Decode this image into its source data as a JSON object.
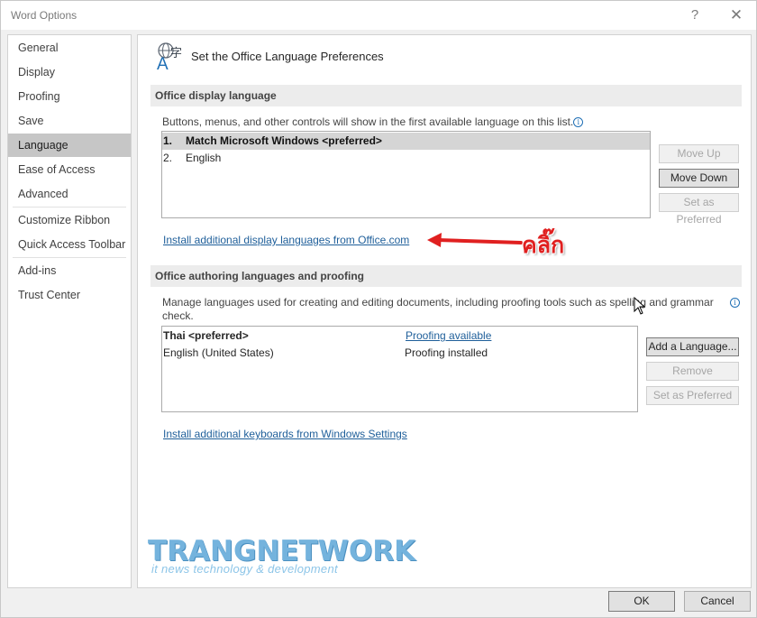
{
  "window": {
    "title": "Word Options",
    "help_glyph": "?",
    "close_glyph": "✕"
  },
  "sidebar": {
    "items": [
      {
        "label": "General"
      },
      {
        "label": "Display"
      },
      {
        "label": "Proofing"
      },
      {
        "label": "Save"
      },
      {
        "label": "Language",
        "selected": true
      },
      {
        "label": "Ease of Access"
      },
      {
        "label": "Advanced"
      },
      {
        "label": "Customize Ribbon"
      },
      {
        "label": "Quick Access Toolbar"
      },
      {
        "label": "Add-ins"
      },
      {
        "label": "Trust Center"
      }
    ]
  },
  "page": {
    "title": "Set the Office Language Preferences",
    "icon_glyph_a": "A",
    "icon_glyph_b": "字",
    "icon": "language-icon"
  },
  "display_language": {
    "heading": "Office display language",
    "description": "Buttons, menus, and other controls will show in the first available language on this list.",
    "languages": [
      {
        "num": "1.",
        "name": "Match Microsoft Windows <preferred>",
        "selected": true
      },
      {
        "num": "2.",
        "name": "English"
      }
    ],
    "move_up_label": "Move Up",
    "move_down_label": "Move Down",
    "set_preferred_label": "Set as Preferred",
    "install_link": "Install additional display languages from Office.com"
  },
  "authoring": {
    "heading": "Office authoring languages and proofing",
    "description": "Manage languages used for creating and editing documents, including proofing tools such as spelling and grammar check.",
    "languages": [
      {
        "name": "Thai <preferred>",
        "status": "Proofing available",
        "status_is_link": true
      },
      {
        "name": "English (United States)",
        "status": "Proofing installed"
      }
    ],
    "add_label": "Add a Language...",
    "remove_label": "Remove",
    "set_preferred_label": "Set as Preferred",
    "keyboards_link": "Install additional keyboards from Windows Settings"
  },
  "annotation": {
    "text": "คลิ๊ก",
    "color": "#e02020"
  },
  "watermark": {
    "title": "TRANGNETWORK",
    "subtitle": "it news technology & development"
  },
  "footer": {
    "ok_label": "OK",
    "cancel_label": "Cancel"
  },
  "colors": {
    "accent_link": "#1f5f9a",
    "selected_nav": "#c6c6c6",
    "watermark": "#74b3dd"
  }
}
